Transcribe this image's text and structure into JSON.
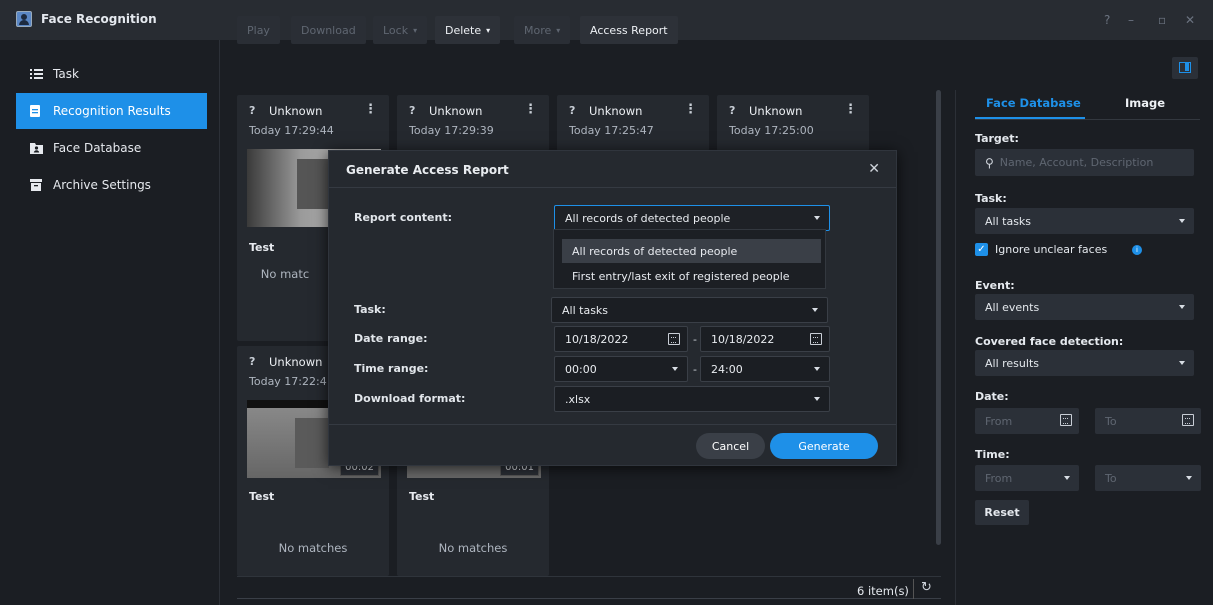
{
  "window": {
    "title": "Face Recognition",
    "controls": [
      "?",
      "–",
      "▫",
      "✕"
    ]
  },
  "sidebar": {
    "items": [
      {
        "label": "Task",
        "icon": "list-icon",
        "active": false
      },
      {
        "label": "Recognition Results",
        "icon": "document-icon",
        "active": true
      },
      {
        "label": "Face Database",
        "icon": "folder-person-icon",
        "active": false
      },
      {
        "label": "Archive Settings",
        "icon": "archive-icon",
        "active": false
      }
    ]
  },
  "toolbar": {
    "play": "Play",
    "download": "Download",
    "lock": "Lock",
    "delete": "Delete",
    "more": "More",
    "access_report": "Access Report"
  },
  "cards": [
    {
      "q": "?",
      "name": "Unknown",
      "time": "Today 17:29:44",
      "label": "Test",
      "nomatch": "No matches",
      "duration": ""
    },
    {
      "q": "?",
      "name": "Unknown",
      "time": "Today 17:29:39",
      "label": "",
      "nomatch": "",
      "duration": ""
    },
    {
      "q": "?",
      "name": "Unknown",
      "time": "Today 17:25:47",
      "label": "",
      "nomatch": "",
      "duration": ""
    },
    {
      "q": "?",
      "name": "Unknown",
      "time": "Today 17:25:00",
      "label": "",
      "nomatch": "",
      "duration": ""
    },
    {
      "q": "?",
      "name": "Unknown",
      "time": "Today 17:22:4",
      "label": "Test",
      "nomatch": "No matches",
      "duration": "00:02"
    },
    {
      "q": "",
      "name": "",
      "time": "",
      "label": "Test",
      "nomatch": "No matches",
      "duration": "00:01"
    }
  ],
  "card0_nomatch_partial": "No matc",
  "footer": {
    "count": "6 item(s)",
    "refresh_icon": "refresh-icon"
  },
  "right_panel": {
    "tabs": [
      "Face Database",
      "Image"
    ],
    "target_label": "Target:",
    "search_placeholder": "Name, Account, Description",
    "task_label": "Task:",
    "task_value": "All tasks",
    "ignore_label": "Ignore unclear faces",
    "event_label": "Event:",
    "event_value": "All events",
    "covered_label": "Covered face detection:",
    "covered_value": "All results",
    "date_label": "Date:",
    "date_from": "From",
    "date_to": "To",
    "time_label": "Time:",
    "time_from": "From",
    "time_to": "To",
    "reset": "Reset"
  },
  "modal": {
    "title": "Generate Access Report",
    "report_content_label": "Report content:",
    "report_content_value": "All records of detected people",
    "options": [
      "All records of detected people",
      "First entry/last exit of registered people"
    ],
    "task_label": "Task:",
    "task_value": "All tasks",
    "date_label": "Date range:",
    "date_from": "10/18/2022",
    "date_to": "10/18/2022",
    "time_label": "Time range:",
    "time_from": "00:00",
    "time_to": "24:00",
    "format_label": "Download format:",
    "format_value": ".xlsx",
    "dash": "-",
    "cancel": "Cancel",
    "generate": "Generate"
  },
  "colors": {
    "accent": "#1e90e8",
    "bg": "#1b1e23",
    "panel": "#25292f"
  }
}
